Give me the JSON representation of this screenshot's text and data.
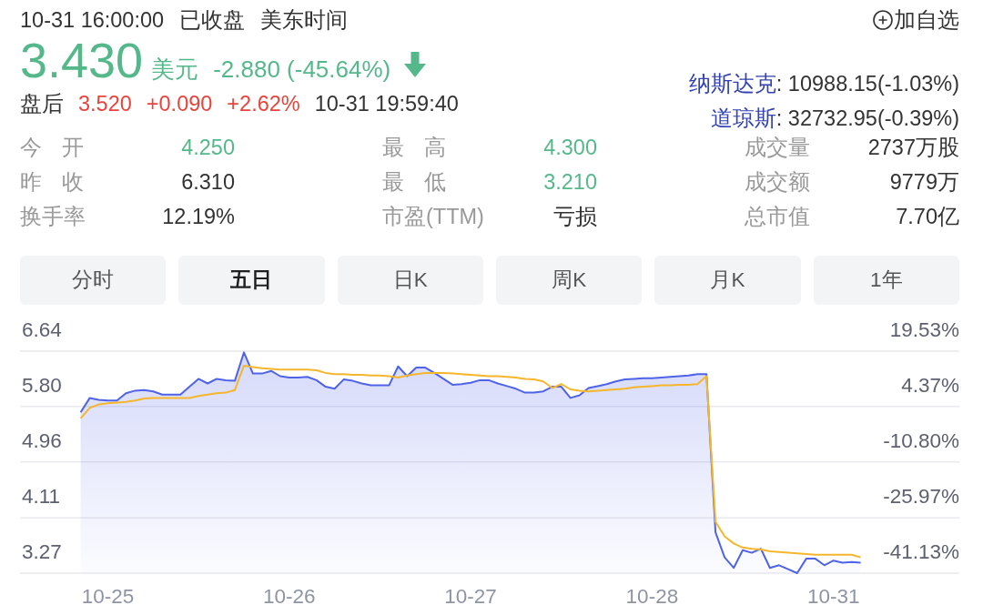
{
  "header": {
    "time": "10-31 16:00:00",
    "market_status": "已收盘",
    "timezone": "美东时间",
    "watchlist_button": "加自选"
  },
  "quote": {
    "price": "3.430",
    "currency": "美元",
    "change": "-2.880 (-45.64%)",
    "falling": true
  },
  "after_hours": {
    "label": "盘后",
    "price": "3.520",
    "change": "+0.090",
    "change_percent": "+2.62%",
    "time": "10-31 19:59:40",
    "falling": false
  },
  "indices": [
    {
      "name": "纳斯达克",
      "value": ": 10988.15(-1.03%)"
    },
    {
      "name": "道琼斯",
      "value": ": 32732.95(-0.39%)"
    }
  ],
  "stats": [
    {
      "label": "今 开",
      "value": "4.250",
      "color": "#55b88b"
    },
    {
      "label": "最 高",
      "value": "4.300",
      "color": "#55b88b"
    },
    {
      "label": "成交量",
      "value": "2737万股",
      "color": "#333333"
    },
    {
      "label": "昨 收",
      "value": "6.310",
      "color": "#333333"
    },
    {
      "label": "最 低",
      "value": "3.210",
      "color": "#55b88b"
    },
    {
      "label": "成交额",
      "value": "9779万",
      "color": "#333333"
    },
    {
      "label": "换手率",
      "value": "12.19%",
      "color": "#333333"
    },
    {
      "label": "市盈(TTM)",
      "value": "亏损",
      "color": "#333333"
    },
    {
      "label": "总市值",
      "value": "7.70亿",
      "color": "#333333"
    }
  ],
  "tabs": [
    {
      "label": "分时",
      "selected": false
    },
    {
      "label": "五日",
      "selected": true
    },
    {
      "label": "日K",
      "selected": false
    },
    {
      "label": "周K",
      "selected": false
    },
    {
      "label": "月K",
      "selected": false
    },
    {
      "label": "1年",
      "selected": false
    }
  ],
  "chart": {
    "percent_labels": [
      "19.53%",
      "4.37%",
      "-10.80%",
      "-25.97%",
      "-41.13%"
    ],
    "chart_data": {
      "type": "area",
      "grid": true,
      "categories": [
        null,
        null,
        null,
        "10-25",
        null,
        null,
        null,
        null,
        null,
        null,
        null,
        null,
        null,
        null,
        null,
        null,
        null,
        null,
        null,
        null,
        null,
        null,
        null,
        "10-26",
        null,
        null,
        null,
        null,
        null,
        null,
        null,
        null,
        null,
        null,
        null,
        null,
        null,
        null,
        null,
        null,
        null,
        null,
        null,
        "10-27",
        null,
        null,
        null,
        null,
        null,
        null,
        null,
        null,
        null,
        null,
        null,
        null,
        null,
        null,
        null,
        null,
        null,
        null,
        null,
        "10-28",
        null,
        null,
        null,
        null,
        null,
        null,
        null,
        null,
        null,
        null,
        null,
        null,
        null,
        null,
        null,
        null,
        null,
        null,
        null,
        "10-31",
        null,
        null,
        null
      ],
      "ylim": [
        3.27,
        6.64
      ],
      "yticks": [
        {
          "value": 6.64,
          "label": "6.64"
        },
        {
          "value": 5.8,
          "label": "5.80"
        },
        {
          "value": 4.96,
          "label": "4.96"
        },
        {
          "value": 4.11,
          "label": "4.11"
        },
        {
          "value": 3.27,
          "label": "3.27"
        }
      ],
      "series": [
        {
          "color": "#4f63e8",
          "values": [
            5.71,
            5.93,
            5.9,
            5.89,
            5.89,
            6.0,
            6.04,
            6.05,
            6.03,
            5.98,
            5.98,
            5.98,
            6.1,
            6.22,
            6.15,
            6.22,
            6.2,
            6.19,
            6.62,
            6.3,
            6.3,
            6.34,
            6.26,
            6.24,
            6.24,
            6.25,
            6.2,
            6.1,
            6.07,
            6.21,
            6.19,
            6.15,
            6.12,
            6.12,
            6.12,
            6.41,
            6.26,
            6.39,
            6.39,
            6.31,
            6.22,
            6.13,
            6.14,
            6.16,
            6.2,
            6.2,
            6.15,
            6.11,
            6.07,
            6.01,
            6.01,
            6.03,
            6.1,
            6.1,
            5.93,
            5.97,
            6.08,
            6.11,
            6.14,
            6.18,
            6.21,
            6.22,
            6.23,
            6.23,
            6.24,
            6.25,
            6.26,
            6.27,
            6.29,
            6.29,
            3.89,
            3.51,
            3.35,
            3.62,
            3.58,
            3.64,
            3.35,
            3.39,
            3.33,
            3.27,
            3.49,
            3.49,
            3.39,
            3.46,
            3.43,
            3.44,
            3.43
          ]
        },
        {
          "type": "line",
          "color": "#f5b62c",
          "values": [
            5.62,
            5.78,
            5.83,
            5.85,
            5.86,
            5.87,
            5.89,
            5.92,
            5.93,
            5.93,
            5.93,
            5.93,
            5.93,
            5.96,
            5.98,
            6.0,
            6.01,
            6.05,
            6.42,
            6.4,
            6.38,
            6.37,
            6.36,
            6.36,
            6.36,
            6.36,
            6.35,
            6.31,
            6.29,
            6.29,
            6.28,
            6.28,
            6.27,
            6.27,
            6.26,
            6.24,
            6.27,
            6.29,
            6.31,
            6.31,
            6.31,
            6.3,
            6.29,
            6.28,
            6.27,
            6.26,
            6.26,
            6.25,
            6.24,
            6.22,
            6.21,
            6.18,
            6.08,
            6.14,
            6.06,
            6.04,
            6.03,
            6.04,
            6.05,
            6.06,
            6.07,
            6.09,
            6.1,
            6.11,
            6.12,
            6.12,
            6.13,
            6.13,
            6.14,
            6.26,
            4.05,
            3.83,
            3.72,
            3.66,
            3.64,
            3.63,
            3.6,
            3.59,
            3.58,
            3.57,
            3.56,
            3.55,
            3.55,
            3.55,
            3.55,
            3.55,
            3.51
          ]
        }
      ]
    }
  }
}
